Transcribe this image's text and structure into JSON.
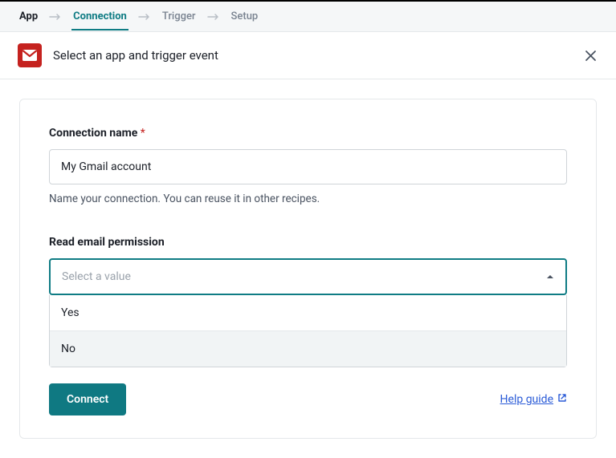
{
  "breadcrumb": {
    "steps": [
      "App",
      "Connection",
      "Trigger",
      "Setup"
    ]
  },
  "header": {
    "title": "Select an app and trigger event"
  },
  "form": {
    "connection_name": {
      "label": "Connection name",
      "required_mark": "*",
      "value": "My Gmail account",
      "help": "Name your connection. You can reuse it in other recipes."
    },
    "read_permission": {
      "label": "Read email permission",
      "placeholder": "Select a value",
      "options": [
        "Yes",
        "No"
      ]
    }
  },
  "footer": {
    "connect": "Connect",
    "help_link": "Help guide"
  }
}
